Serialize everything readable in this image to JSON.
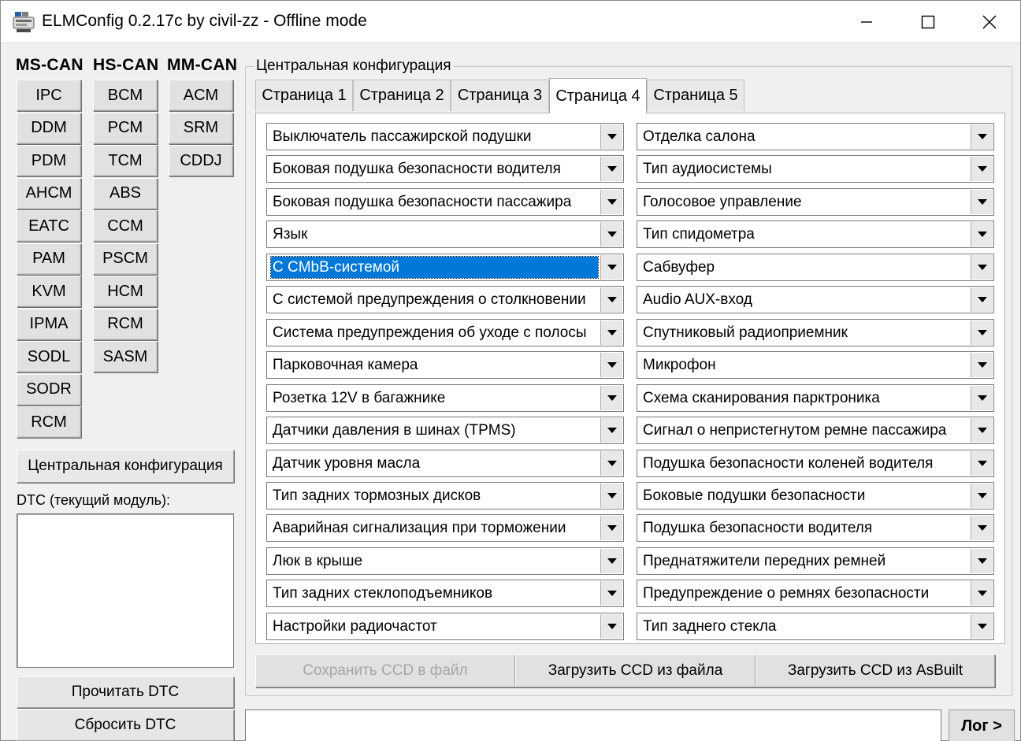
{
  "window": {
    "title": "ELMConfig 0.2.17c by civil-zz - Offline mode",
    "icon": "elm-config-app-icon"
  },
  "buses": {
    "ms_can": {
      "label": "MS-CAN",
      "modules": [
        "IPC",
        "DDM",
        "PDM",
        "AHCM",
        "EATC",
        "PAM",
        "KVM",
        "IPMA",
        "SODL",
        "SODR",
        "RCM"
      ]
    },
    "hs_can": {
      "label": "HS-CAN",
      "modules": [
        "BCM",
        "PCM",
        "TCM",
        "ABS",
        "CCM",
        "PSCM",
        "HCM",
        "RCM",
        "SASM"
      ]
    },
    "mm_can": {
      "label": "MM-CAN",
      "modules": [
        "ACM",
        "SRM",
        "CDDJ"
      ]
    }
  },
  "sidebar": {
    "central_config_button": "Центральная конфигурация",
    "dtc_label": "DTC (текущий модуль):",
    "read_dtc": "Прочитать DTC",
    "clear_dtc": "Сбросить DTC"
  },
  "central": {
    "group_title": "Центральная конфигурация",
    "tabs": [
      "Страница 1",
      "Страница 2",
      "Страница 3",
      "Страница 4",
      "Страница 5"
    ],
    "active_tab": "Страница 4",
    "left_options": [
      "Выключатель пассажирской подушки",
      "Боковая подушка безопасности водителя",
      "Боковая подушка безопасности пассажира",
      "Язык",
      "С CMbB-системой",
      "С системой предупреждения о столкновении",
      "Система предупреждения об уходе с полосы",
      "Парковочная камера",
      "Розетка 12V в багажнике",
      "Датчики давления в шинах (TPMS)",
      "Датчик уровня масла",
      "Тип задних тормозных дисков",
      "Аварийная сигнализация при торможении",
      "Люк в крыше",
      "Тип задних стеклоподъемников",
      "Настройки радиочастот"
    ],
    "right_options": [
      "Отделка салона",
      "Тип аудиосистемы",
      "Голосовое управление",
      "Тип спидометра",
      "Сабвуфер",
      "Audio AUX-вход",
      "Спутниковый радиоприемник",
      "Микрофон",
      "Схема сканирования парктроника",
      "Сигнал о непристегнутом ремне пассажира",
      "Подушка безопасности коленей водителя",
      "Боковые подушки безопасности",
      "Подушка безопасности водителя",
      "Преднатяжители передних ремней",
      "Предупреждение о ремнях безопасности",
      "Тип заднего стекла"
    ],
    "selected_option": "С CMbB-системой",
    "save_ccd": "Сохранить CCD в файл",
    "load_ccd_file": "Загрузить CCD из файла",
    "load_ccd_asbuilt": "Загрузить CCD из AsBuilt"
  },
  "status": {
    "text": "",
    "log_button": "Лог >"
  },
  "colors": {
    "selection": "#0078d7",
    "background": "#f0f0f0"
  }
}
